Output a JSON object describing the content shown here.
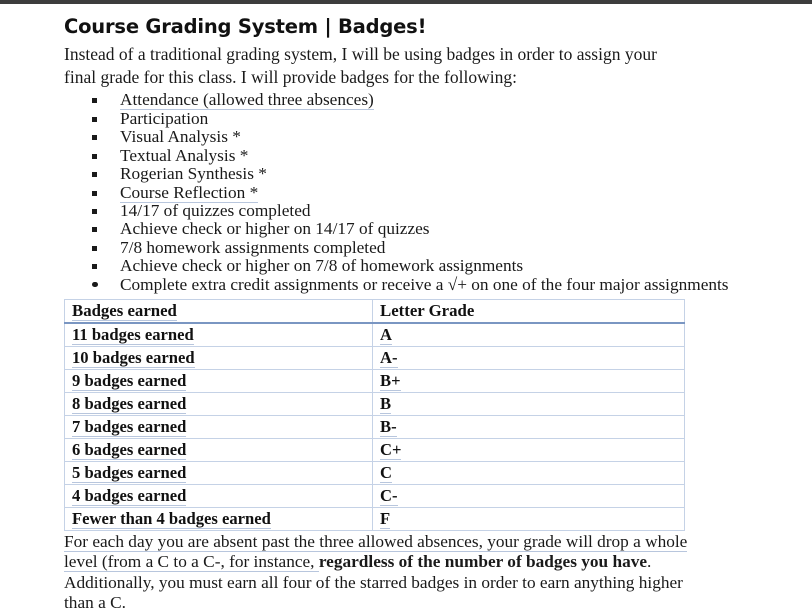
{
  "document": {
    "title": "Course Grading System | Badges!",
    "intro": "Instead of a traditional grading system, I will be using badges in order to assign your final grade for this class. I will provide badges for the following:",
    "badge_list": [
      {
        "text": "Attendance (allowed three absences)",
        "bullet": "square",
        "underlined": true
      },
      {
        "text": "Participation",
        "bullet": "square",
        "underlined": false
      },
      {
        "text": "Visual Analysis *",
        "bullet": "square",
        "underlined": false
      },
      {
        "text": "Textual Analysis *",
        "bullet": "square",
        "underlined": false
      },
      {
        "text": "Rogerian Synthesis *",
        "bullet": "square",
        "underlined": false
      },
      {
        "text": "Course Reflection *",
        "bullet": "square",
        "underlined": true
      },
      {
        "text": "14/17 of quizzes completed",
        "bullet": "square",
        "underlined": false
      },
      {
        "text": "Achieve check or higher on 14/17 of quizzes",
        "bullet": "square",
        "underlined": false
      },
      {
        "text": "7/8 homework assignments completed",
        "bullet": "square",
        "underlined": false
      },
      {
        "text": "Achieve check or higher on 7/8 of homework assignments",
        "bullet": "square",
        "underlined": false
      },
      {
        "text": "Complete extra credit assignments or receive a √+ on one of the four major assignments",
        "bullet": "round",
        "underlined": false
      }
    ],
    "table": {
      "headers": [
        "Badges earned",
        "Letter Grade"
      ],
      "rows": [
        [
          "11 badges earned",
          "A"
        ],
        [
          "10 badges earned",
          "A-"
        ],
        [
          "9 badges earned",
          "B+"
        ],
        [
          "8 badges earned",
          "B"
        ],
        [
          "7 badges earned",
          "B-"
        ],
        [
          "6 badges earned",
          "C+"
        ],
        [
          "5 badges earned",
          "C"
        ],
        [
          "4 badges earned",
          "C-"
        ],
        [
          "Fewer than 4 badges earned",
          "F"
        ]
      ]
    },
    "footer": {
      "paragraph1_part1": "For each day you are absent past the three allowed absences, your grade will drop a whole level (from a C to a C-, for instance, ",
      "paragraph1_bold": "regardless of the number of badges you have",
      "paragraph1_part2": ".",
      "paragraph2": "Additionally, you must earn all four of the starred badges in order to earn anything higher than a C."
    }
  }
}
